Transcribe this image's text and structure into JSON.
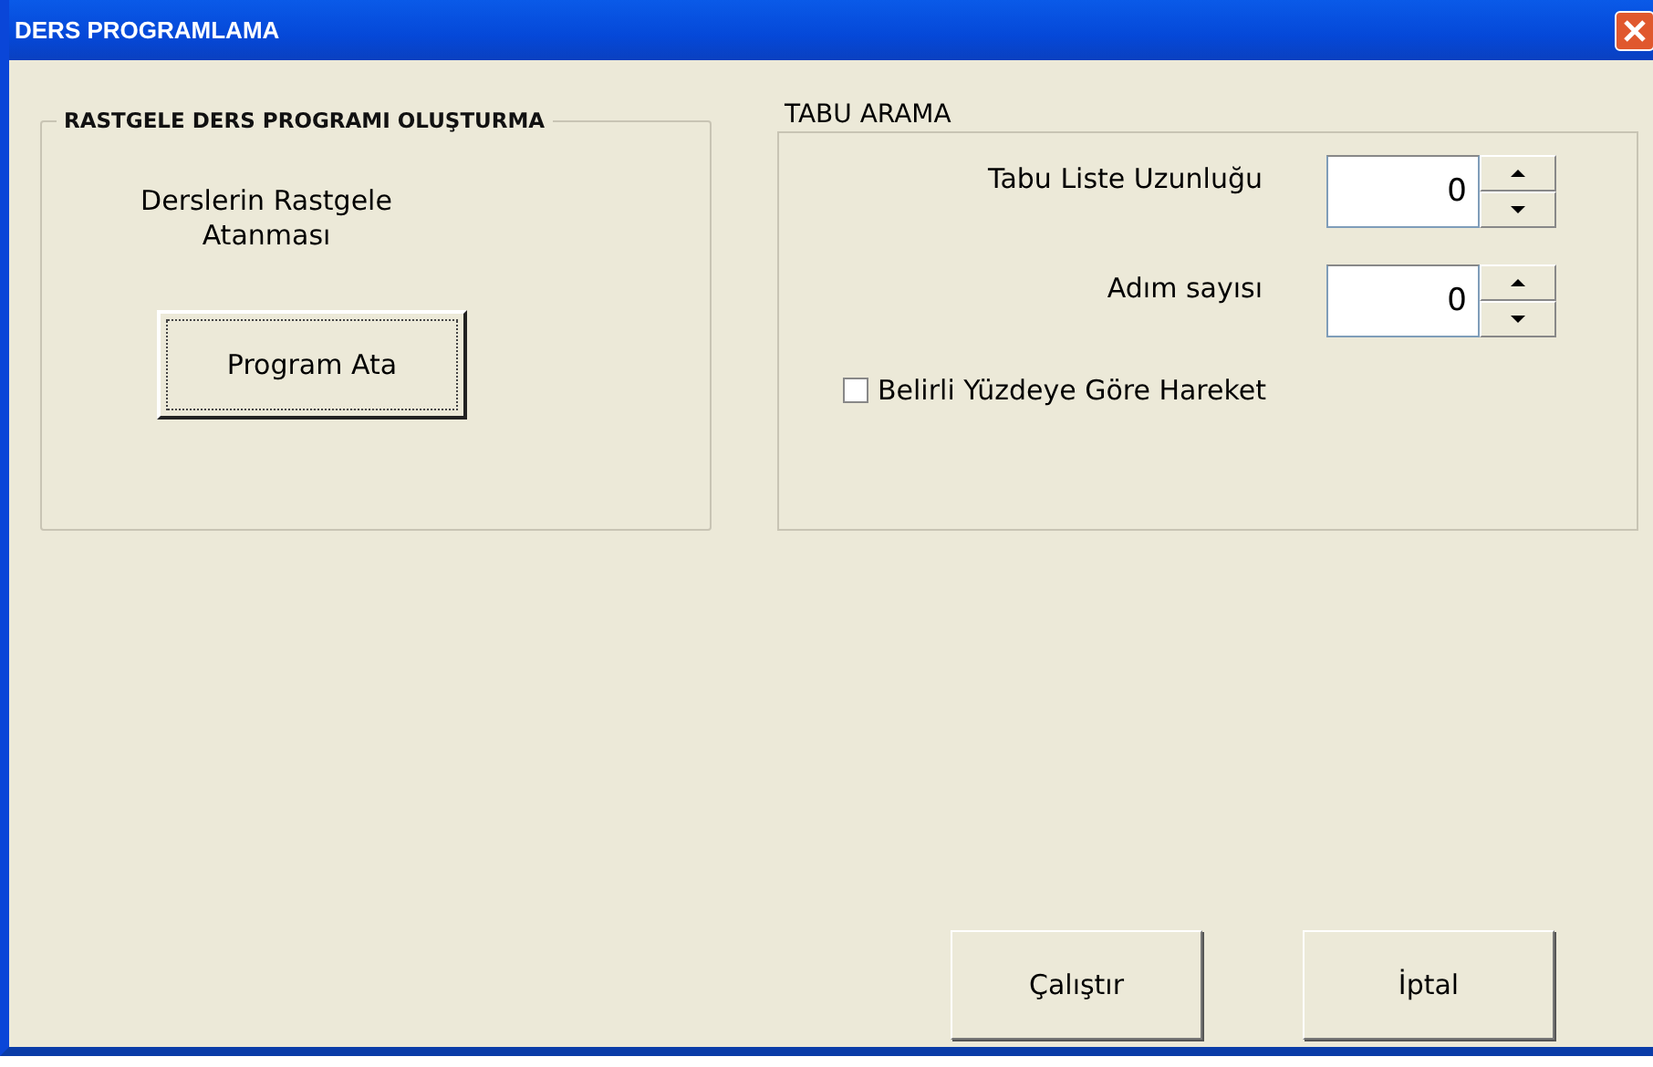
{
  "window": {
    "title": "DERS PROGRAMLAMA"
  },
  "random_group": {
    "title": "RASTGELE DERS PROGRAMI OLUŞTURMA",
    "description": "Derslerin Rastgele Atanması",
    "button": "Program Ata"
  },
  "tabu_group": {
    "title": "TABU ARAMA",
    "spinners": [
      {
        "label": "Tabu Liste Uzunluğu",
        "value": "0"
      },
      {
        "label": "Adım sayısı",
        "value": "0"
      }
    ],
    "checkbox": {
      "label": "Belirli Yüzdeye Göre Hareket",
      "checked": false
    }
  },
  "buttons": [
    "Çalıştır",
    "İptal"
  ]
}
